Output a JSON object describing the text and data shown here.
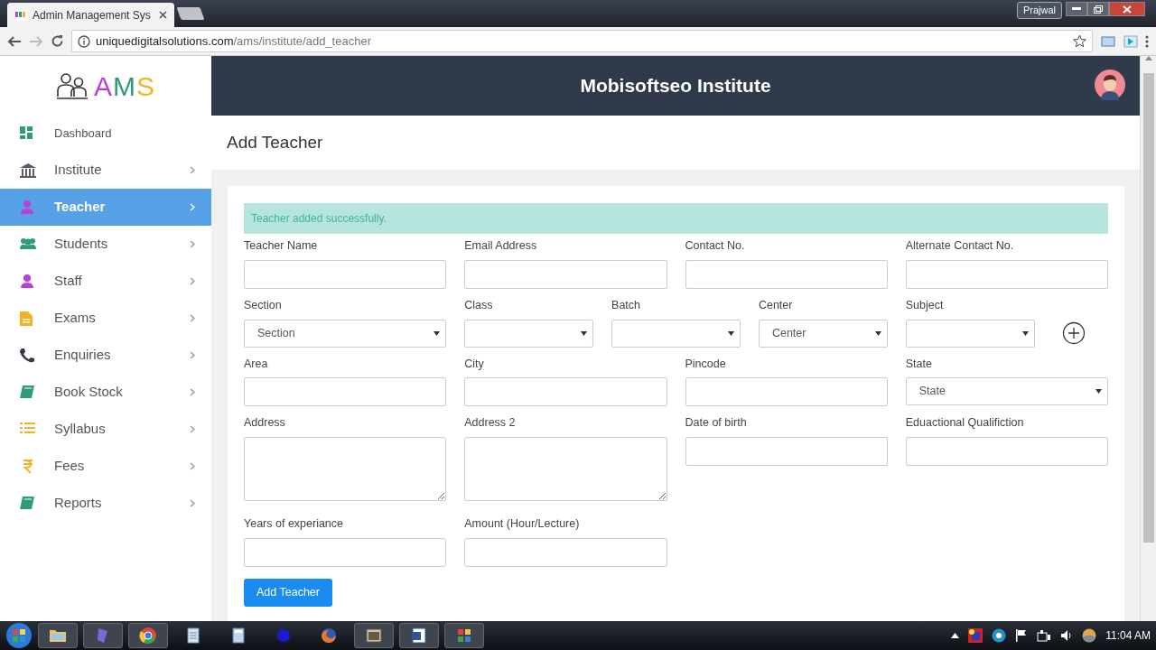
{
  "browser": {
    "tab_title": "Admin Management Sys",
    "url_host": "uniquedigitalsolutions.com",
    "url_path": "/ams/institute/add_teacher",
    "user": "Prajwal"
  },
  "logo": {
    "text": "AMS"
  },
  "header": {
    "title": "Mobisoftseo Institute"
  },
  "sidebar": {
    "items": [
      {
        "label": "Dashboard",
        "chevron": false,
        "selected": false
      },
      {
        "label": "Institute",
        "chevron": true,
        "selected": false
      },
      {
        "label": "Teacher",
        "chevron": true,
        "selected": true
      },
      {
        "label": "Students",
        "chevron": true,
        "selected": false
      },
      {
        "label": "Staff",
        "chevron": true,
        "selected": false
      },
      {
        "label": "Exams",
        "chevron": true,
        "selected": false
      },
      {
        "label": "Enquiries",
        "chevron": true,
        "selected": false
      },
      {
        "label": "Book Stock",
        "chevron": true,
        "selected": false
      },
      {
        "label": "Syllabus",
        "chevron": true,
        "selected": false
      },
      {
        "label": "Fees",
        "chevron": true,
        "selected": false
      },
      {
        "label": "Reports",
        "chevron": true,
        "selected": false
      }
    ]
  },
  "page": {
    "title": "Add Teacher"
  },
  "alert": "Teacher added successfully.",
  "form": {
    "rows": [
      [
        {
          "label": "Teacher Name",
          "kind": "text"
        },
        {
          "label": "Email Address",
          "kind": "text"
        },
        {
          "label": "Contact No.",
          "kind": "text"
        },
        {
          "label": "Alternate Contact No.",
          "kind": "text"
        }
      ],
      [
        {
          "label": "Section",
          "kind": "select",
          "value": "Section"
        },
        {
          "label": "Class",
          "kind": "select"
        },
        {
          "label": "Batch",
          "kind": "select"
        },
        {
          "label": "Center",
          "kind": "select",
          "value": "Center"
        },
        {
          "label": "Subject",
          "kind": "select"
        },
        {
          "kind": "add"
        }
      ],
      [
        {
          "label": "Area",
          "kind": "text"
        },
        {
          "label": "City",
          "kind": "text"
        },
        {
          "label": "Pincode",
          "kind": "text"
        },
        {
          "label": "State",
          "kind": "select",
          "value": "State"
        }
      ],
      [
        {
          "label": "Address",
          "kind": "textarea"
        },
        {
          "label": "Address 2",
          "kind": "textarea"
        },
        {
          "label": "Date of birth",
          "kind": "text"
        },
        {
          "label": "Eduactional Qualifiction",
          "kind": "text"
        }
      ],
      [
        {
          "label": "Years of experiance",
          "kind": "text"
        },
        {
          "label": "Amount (Hour/Lecture)",
          "kind": "text"
        }
      ]
    ],
    "submit": "Add Teacher"
  },
  "taskbar": {
    "clock": "11:04 AM"
  }
}
